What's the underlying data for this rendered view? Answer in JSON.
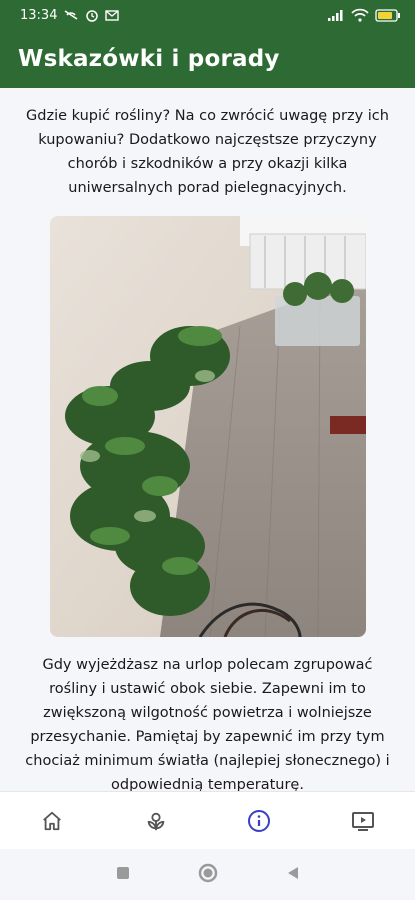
{
  "status": {
    "time": "13:34",
    "battery_color": "#f2d438"
  },
  "app_bar": {
    "title": "Wskazówki i porady"
  },
  "content": {
    "intro": "Gdzie kupić rośliny? Na co zwrócić uwagę przy ich kupowaniu? Dodatkowo najczęstsze przyczyny chorób i szkodników a przy okazji kilka uniwersalnych porad pielegnacyjnych.",
    "tip": "Gdy wyjeżdżasz na urlop polecam zgrupować rośliny  i ustawić obok siebie. Zapewni im to zwiększoną wilgotność powietrza i wolniejsze przesychanie. Pamiętaj by zapewnić im przy tym chociaż minimum światła (najlepiej słonecznego) i odpowiednią temperaturę."
  },
  "bottom_nav": {
    "items": [
      {
        "icon": "home-icon",
        "active": false
      },
      {
        "icon": "plant-icon",
        "active": false
      },
      {
        "icon": "info-icon",
        "active": true
      },
      {
        "icon": "tv-play-icon",
        "active": false
      }
    ],
    "active_color": "#3b3fc4",
    "inactive_color": "#555555"
  },
  "colors": {
    "primary": "#2e6b34",
    "background": "#f4f6fa"
  }
}
